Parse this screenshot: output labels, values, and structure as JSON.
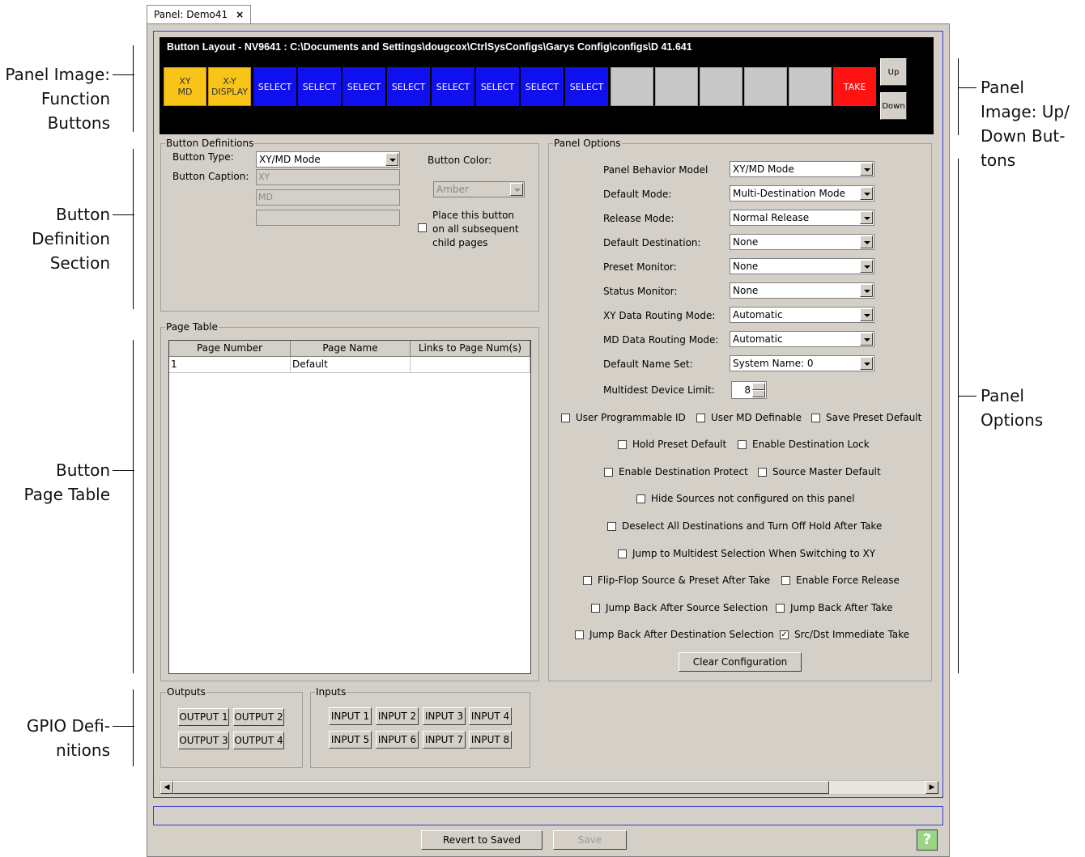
{
  "annotations": {
    "left": [
      {
        "lines": [
          "Panel Image:",
          "Function",
          "Buttons"
        ]
      },
      {
        "lines": [
          "Button",
          "Definition",
          "Section"
        ]
      },
      {
        "lines": [
          "Button",
          "Page Table"
        ]
      },
      {
        "lines": [
          "GPIO Defi-",
          "nitions"
        ]
      }
    ],
    "right": [
      {
        "lines": [
          "Panel",
          "Image: Up/",
          "Down But-",
          "tons"
        ]
      },
      {
        "lines": [
          "Panel",
          "Options"
        ]
      }
    ]
  },
  "tab": {
    "label": "Panel: Demo41",
    "close": "×"
  },
  "panel_image": {
    "title": "Button Layout - NV9641 : C:\\Documents and Settings\\dougcox\\CtrlSysConfigs\\Garys Config\\configs\\D 41.641",
    "buttons": [
      {
        "label": "XY\nMD",
        "color": "#f8c418"
      },
      {
        "label": "X-Y\nDISPLAY",
        "color": "#f8c418"
      },
      {
        "label": "SELECT",
        "color": "#1010ee"
      },
      {
        "label": "SELECT",
        "color": "#1010ee"
      },
      {
        "label": "SELECT",
        "color": "#1010ee"
      },
      {
        "label": "SELECT",
        "color": "#1010ee"
      },
      {
        "label": "SELECT",
        "color": "#1010ee"
      },
      {
        "label": "SELECT",
        "color": "#1010ee"
      },
      {
        "label": "SELECT",
        "color": "#1010ee"
      },
      {
        "label": "SELECT",
        "color": "#1010ee"
      },
      {
        "label": "",
        "color": "#c8c8c8"
      },
      {
        "label": "",
        "color": "#c8c8c8"
      },
      {
        "label": "",
        "color": "#c8c8c8"
      },
      {
        "label": "",
        "color": "#c8c8c8"
      },
      {
        "label": "",
        "color": "#c8c8c8"
      },
      {
        "label": "TAKE",
        "color": "#ff1212"
      }
    ],
    "up": "Up",
    "down": "Down"
  },
  "button_definitions": {
    "legend": "Button Definitions",
    "type_label": "Button Type:",
    "type_value": "XY/MD Mode",
    "caption_label": "Button Caption:",
    "caption_1": "XY",
    "caption_2": "MD",
    "caption_3": "",
    "color_label": "Button Color:",
    "color_value": "Amber",
    "place_checkbox_lines": [
      "Place this button",
      "on all subsequent",
      "child pages"
    ]
  },
  "page_table": {
    "legend": "Page Table",
    "columns": [
      "Page Number",
      "Page Name",
      "Links to Page Num(s)"
    ],
    "rows": [
      [
        "1",
        "Default",
        ""
      ]
    ]
  },
  "panel_options": {
    "legend": "Panel Options",
    "fields": [
      {
        "label": "Panel Behavior Model",
        "value": "XY/MD Mode"
      },
      {
        "label": "Default Mode:",
        "value": "Multi-Destination Mode"
      },
      {
        "label": "Release Mode:",
        "value": "Normal Release"
      },
      {
        "label": "Default Destination:",
        "value": "None"
      },
      {
        "label": "Preset Monitor:",
        "value": "None"
      },
      {
        "label": "Status Monitor:",
        "value": "None"
      },
      {
        "label": "XY Data Routing Mode:",
        "value": "Automatic"
      },
      {
        "label": "MD Data Routing Mode:",
        "value": "Automatic"
      },
      {
        "label": "Default Name Set:",
        "value": "System Name: 0"
      }
    ],
    "limit_label": "Multidest Device Limit:",
    "limit_value": "8",
    "checkboxes": [
      {
        "label": "User Programmable ID",
        "checked": false
      },
      {
        "label": "User MD Definable",
        "checked": false
      },
      {
        "label": "Save Preset Default",
        "checked": false
      },
      {
        "label": "Hold Preset Default",
        "checked": false
      },
      {
        "label": "Enable Destination Lock",
        "checked": false
      },
      {
        "label": "Enable Destination Protect",
        "checked": false
      },
      {
        "label": "Source Master Default",
        "checked": false
      },
      {
        "label": "Hide Sources not configured on this panel",
        "checked": false
      },
      {
        "label": "Deselect All Destinations and Turn Off Hold After Take",
        "checked": false
      },
      {
        "label": "Jump to Multidest Selection When Switching to XY",
        "checked": false
      },
      {
        "label": "Flip-Flop Source & Preset After Take",
        "checked": false
      },
      {
        "label": "Enable Force Release",
        "checked": false
      },
      {
        "label": "Jump Back After Source Selection",
        "checked": false
      },
      {
        "label": "Jump Back After Take",
        "checked": false
      },
      {
        "label": "Jump Back After Destination Selection",
        "checked": false
      },
      {
        "label": "Src/Dst Immediate Take",
        "checked": true
      }
    ],
    "clear_button": "Clear Configuration"
  },
  "gpio": {
    "outputs_legend": "Outputs",
    "outputs": [
      "OUTPUT 1",
      "OUTPUT 2",
      "OUTPUT 3",
      "OUTPUT 4"
    ],
    "inputs_legend": "Inputs",
    "inputs": [
      "INPUT 1",
      "INPUT 2",
      "INPUT 3",
      "INPUT 4",
      "INPUT 5",
      "INPUT 6",
      "INPUT 7",
      "INPUT 8"
    ]
  },
  "footer": {
    "revert": "Revert to Saved",
    "save": "Save",
    "help": "?"
  }
}
